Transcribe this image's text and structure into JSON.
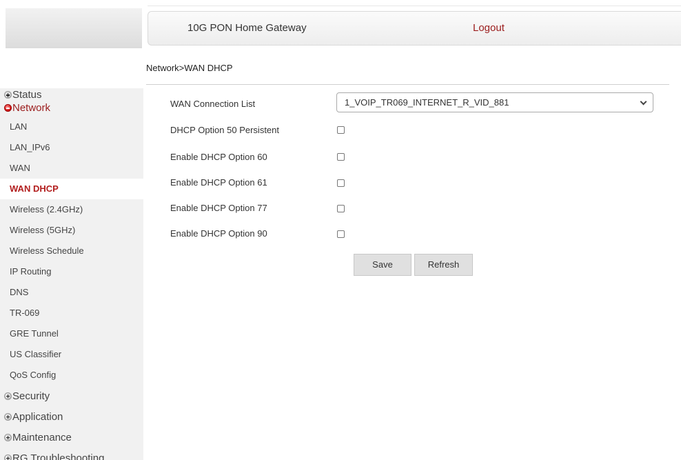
{
  "header": {
    "title": "10G PON Home Gateway",
    "logout_label": "Logout"
  },
  "breadcrumb": "Network>WAN DHCP",
  "sidebar": {
    "groups": [
      {
        "label": "Status",
        "expanded": false
      },
      {
        "label": "Network",
        "expanded": true
      },
      {
        "label": "Security",
        "expanded": false
      },
      {
        "label": "Application",
        "expanded": false
      },
      {
        "label": "Maintenance",
        "expanded": false
      },
      {
        "label": "RG Troubleshooting",
        "expanded": false
      }
    ],
    "network_items": [
      "LAN",
      "LAN_IPv6",
      "WAN",
      "WAN DHCP",
      "Wireless (2.4GHz)",
      "Wireless (5GHz)",
      "Wireless Schedule",
      "IP Routing",
      "DNS",
      "TR-069",
      "GRE Tunnel",
      "US Classifier",
      "QoS Config"
    ],
    "active_item": "WAN DHCP"
  },
  "form": {
    "wan_connection_label": "WAN Connection List",
    "wan_connection_value": "1_VOIP_TR069_INTERNET_R_VID_881",
    "options": [
      {
        "label": "DHCP Option 50 Persistent",
        "checked": false
      },
      {
        "label": "Enable DHCP Option 60",
        "checked": false
      },
      {
        "label": "Enable DHCP Option 61",
        "checked": false
      },
      {
        "label": "Enable DHCP Option 77",
        "checked": false
      },
      {
        "label": "Enable DHCP Option 90",
        "checked": false
      }
    ],
    "save_label": "Save",
    "refresh_label": "Refresh"
  },
  "colors": {
    "accent_red": "#9b1c1c",
    "active_item_red": "#b21e1e",
    "sidebar_bg": "#f1f1f1"
  }
}
